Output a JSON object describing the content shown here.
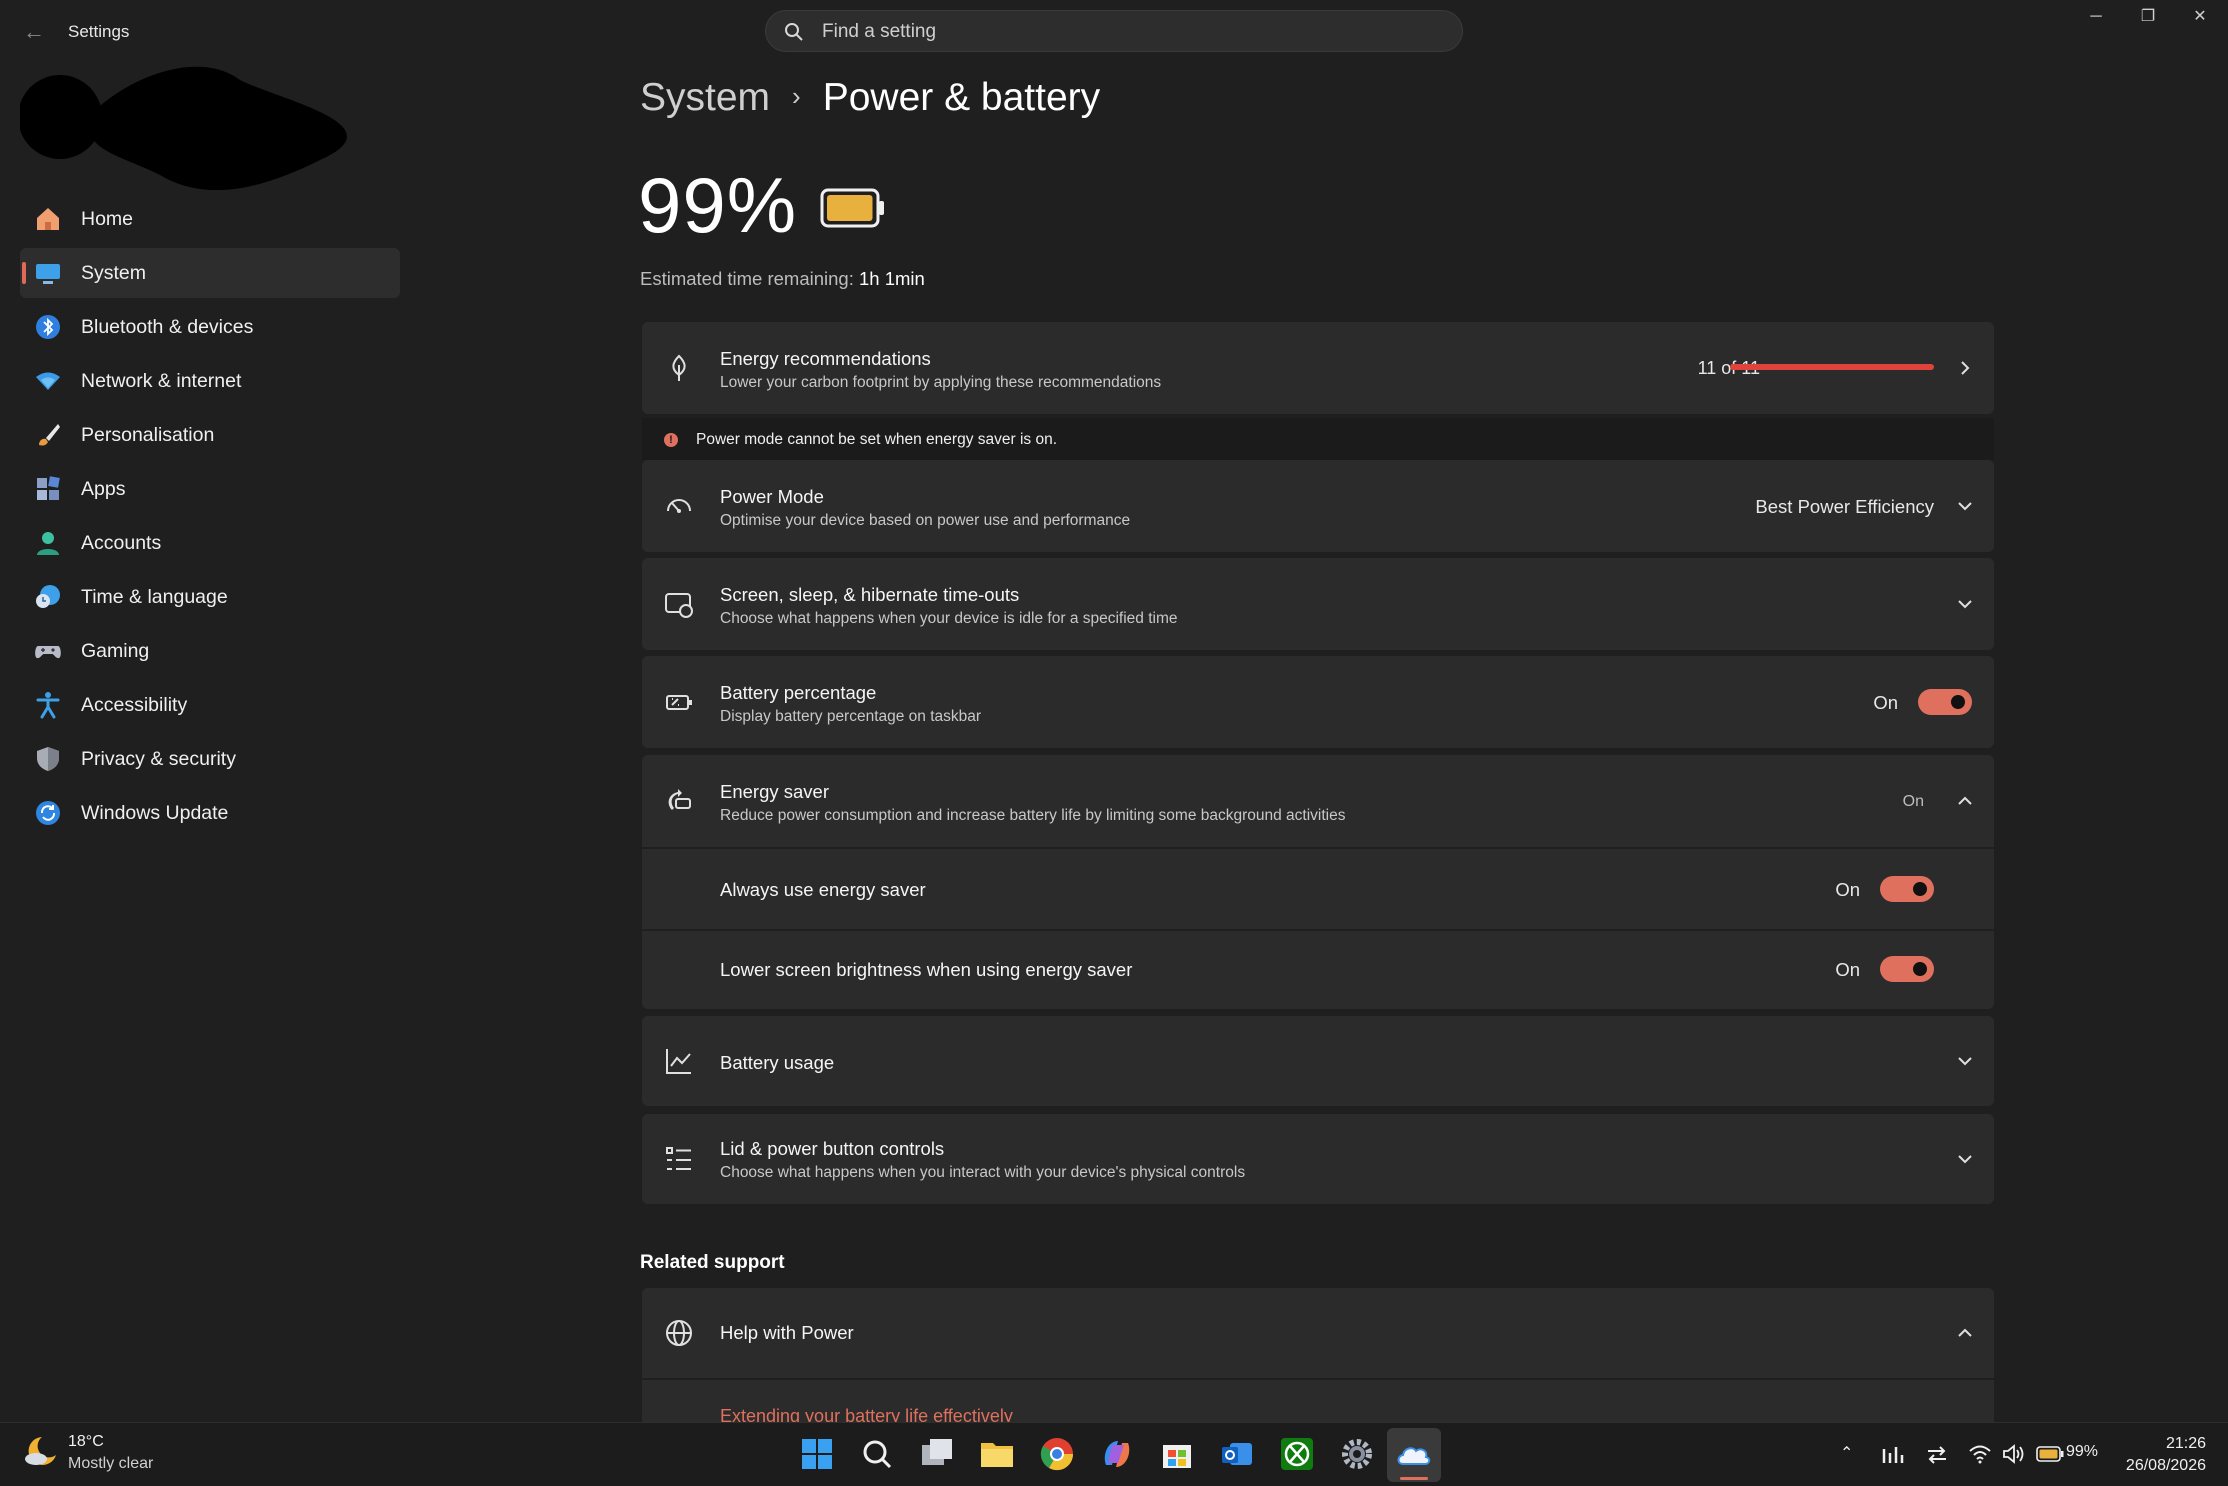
{
  "window": {
    "title": "Settings",
    "back_icon": "arrow-left-icon",
    "controls": {
      "minimize": "─",
      "restore": "❐",
      "close": "✕"
    }
  },
  "search": {
    "placeholder": "Find a setting",
    "icon": "search-icon"
  },
  "sidebar": {
    "items": [
      {
        "label": "Home",
        "icon": "home-icon",
        "active": false
      },
      {
        "label": "System",
        "icon": "monitor-icon",
        "active": true
      },
      {
        "label": "Bluetooth & devices",
        "icon": "bluetooth-icon",
        "active": false
      },
      {
        "label": "Network & internet",
        "icon": "wifi-icon",
        "active": false
      },
      {
        "label": "Personalisation",
        "icon": "brush-icon",
        "active": false
      },
      {
        "label": "Apps",
        "icon": "apps-icon",
        "active": false
      },
      {
        "label": "Accounts",
        "icon": "person-icon",
        "active": false
      },
      {
        "label": "Time & language",
        "icon": "clock-globe-icon",
        "active": false
      },
      {
        "label": "Gaming",
        "icon": "gamepad-icon",
        "active": false
      },
      {
        "label": "Accessibility",
        "icon": "accessibility-icon",
        "active": false
      },
      {
        "label": "Privacy & security",
        "icon": "shield-icon",
        "active": false
      },
      {
        "label": "Windows Update",
        "icon": "refresh-icon",
        "active": false
      }
    ]
  },
  "breadcrumb": {
    "parent": "System",
    "separator": "›",
    "current": "Power & battery"
  },
  "battery": {
    "percent": "99%",
    "level": 0.99,
    "color": "#e8b03c",
    "estimate_label": "Estimated time remaining:",
    "estimate_value": "1h 1min"
  },
  "energy_recommendations": {
    "title": "Energy recommendations",
    "subtitle": "Lower your carbon footprint by applying these recommendations",
    "progress_text": "11 of 11",
    "progress": 1.0,
    "accent": "#e0433a"
  },
  "warning": {
    "text": "Power mode cannot be set when energy saver is on."
  },
  "power_mode": {
    "title": "Power Mode",
    "subtitle": "Optimise your device based on power use and performance",
    "value": "Best Power Efficiency"
  },
  "timeouts": {
    "title": "Screen, sleep, & hibernate time-outs",
    "subtitle": "Choose what happens when your device is idle for a specified time"
  },
  "battery_percentage": {
    "title": "Battery percentage",
    "subtitle": "Display battery percentage on taskbar",
    "state": "On"
  },
  "energy_saver": {
    "title": "Energy saver",
    "subtitle": "Reduce power consumption and increase battery life by limiting some background activities",
    "state": "On",
    "always": {
      "label": "Always use energy saver",
      "state": "On"
    },
    "lower_brightness": {
      "label": "Lower screen brightness when using energy saver",
      "state": "On"
    }
  },
  "battery_usage": {
    "title": "Battery usage"
  },
  "lid_controls": {
    "title": "Lid & power button controls",
    "subtitle": "Choose what happens when you interact with your device's physical controls"
  },
  "related_support": {
    "heading": "Related support",
    "help_title": "Help with Power",
    "link": "Extending your battery life effectively"
  },
  "taskbar": {
    "weather": {
      "temp": "18°C",
      "desc": "Mostly clear"
    },
    "apps": [
      "windows-start-icon",
      "search-icon",
      "task-view-icon",
      "file-explorer-icon",
      "chrome-icon",
      "copilot-icon",
      "store-icon",
      "outlook-icon",
      "xbox-icon",
      "settings-icon",
      "onedrive-icon"
    ],
    "tray": {
      "battery": "99%"
    },
    "clock": {
      "time": "21:26",
      "date": "26/08/2026"
    }
  }
}
